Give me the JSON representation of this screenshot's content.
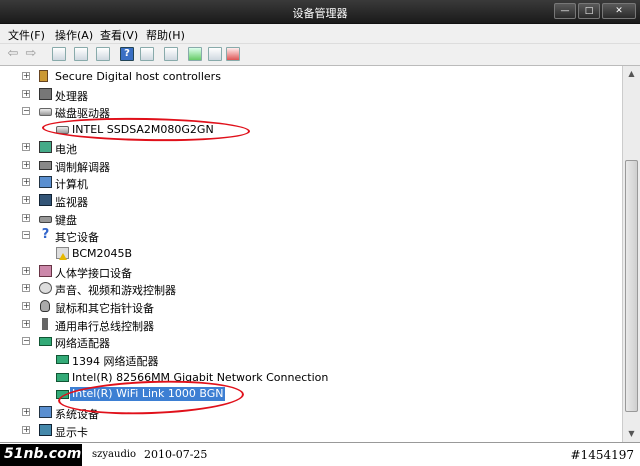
{
  "window": {
    "title": "设备管理器",
    "minimize": "—",
    "maximize": "□",
    "close": "✕"
  },
  "menu": [
    "文件(F)",
    "操作(A)",
    "查看(V)",
    "帮助(H)"
  ],
  "toolbar": {
    "back": "⇦",
    "forward": "⇨",
    "help": "?"
  },
  "tree": [
    {
      "label": "Secure Digital host controllers",
      "icon": "sd-card-icon",
      "expander": "+"
    },
    {
      "label": "处理器",
      "icon": "processor-icon",
      "expander": "+"
    },
    {
      "label": "磁盘驱动器",
      "icon": "drive-icon",
      "expander": "−"
    },
    {
      "label": "INTEL SSDSA2M080G2GN",
      "icon": "drive-icon",
      "expander": ""
    },
    {
      "label": "电池",
      "icon": "battery-icon",
      "expander": "+"
    },
    {
      "label": "调制解调器",
      "icon": "modem-icon",
      "expander": "+"
    },
    {
      "label": "计算机",
      "icon": "computer-icon",
      "expander": "+"
    },
    {
      "label": "监视器",
      "icon": "monitor-icon",
      "expander": "+"
    },
    {
      "label": "键盘",
      "icon": "keyboard-icon",
      "expander": "+"
    },
    {
      "label": "其它设备",
      "icon": "question-icon",
      "expander": "−"
    },
    {
      "label": "BCM2045B",
      "icon": "unknown-device-icon",
      "expander": ""
    },
    {
      "label": "人体学接口设备",
      "icon": "hid-icon",
      "expander": "+"
    },
    {
      "label": "声音、视频和游戏控制器",
      "icon": "sound-icon",
      "expander": "+"
    },
    {
      "label": "鼠标和其它指针设备",
      "icon": "mouse-icon",
      "expander": "+"
    },
    {
      "label": "通用串行总线控制器",
      "icon": "usb-icon",
      "expander": "+"
    },
    {
      "label": "网络适配器",
      "icon": "network-icon",
      "expander": "−"
    },
    {
      "label": "1394 网络适配器",
      "icon": "network-card-icon",
      "expander": ""
    },
    {
      "label": "Intel(R) 82566MM Gigabit Network Connection",
      "icon": "network-card-icon",
      "expander": ""
    },
    {
      "label": "Intel(R) WiFi Link 1000 BGN",
      "icon": "network-card-icon",
      "expander": "",
      "selected": true
    },
    {
      "label": "系统设备",
      "icon": "system-device-icon",
      "expander": "+"
    },
    {
      "label": "显示卡",
      "icon": "display-adapter-icon",
      "expander": "+"
    }
  ],
  "watermark": {
    "logo": "51nb.com",
    "user": "szyaudio",
    "date": "2010-07-25",
    "id": "#1454197"
  },
  "colors": {
    "selection": "#3d7fd3",
    "annotation": "#e0101a",
    "titlebar": "#2a2a2a"
  }
}
